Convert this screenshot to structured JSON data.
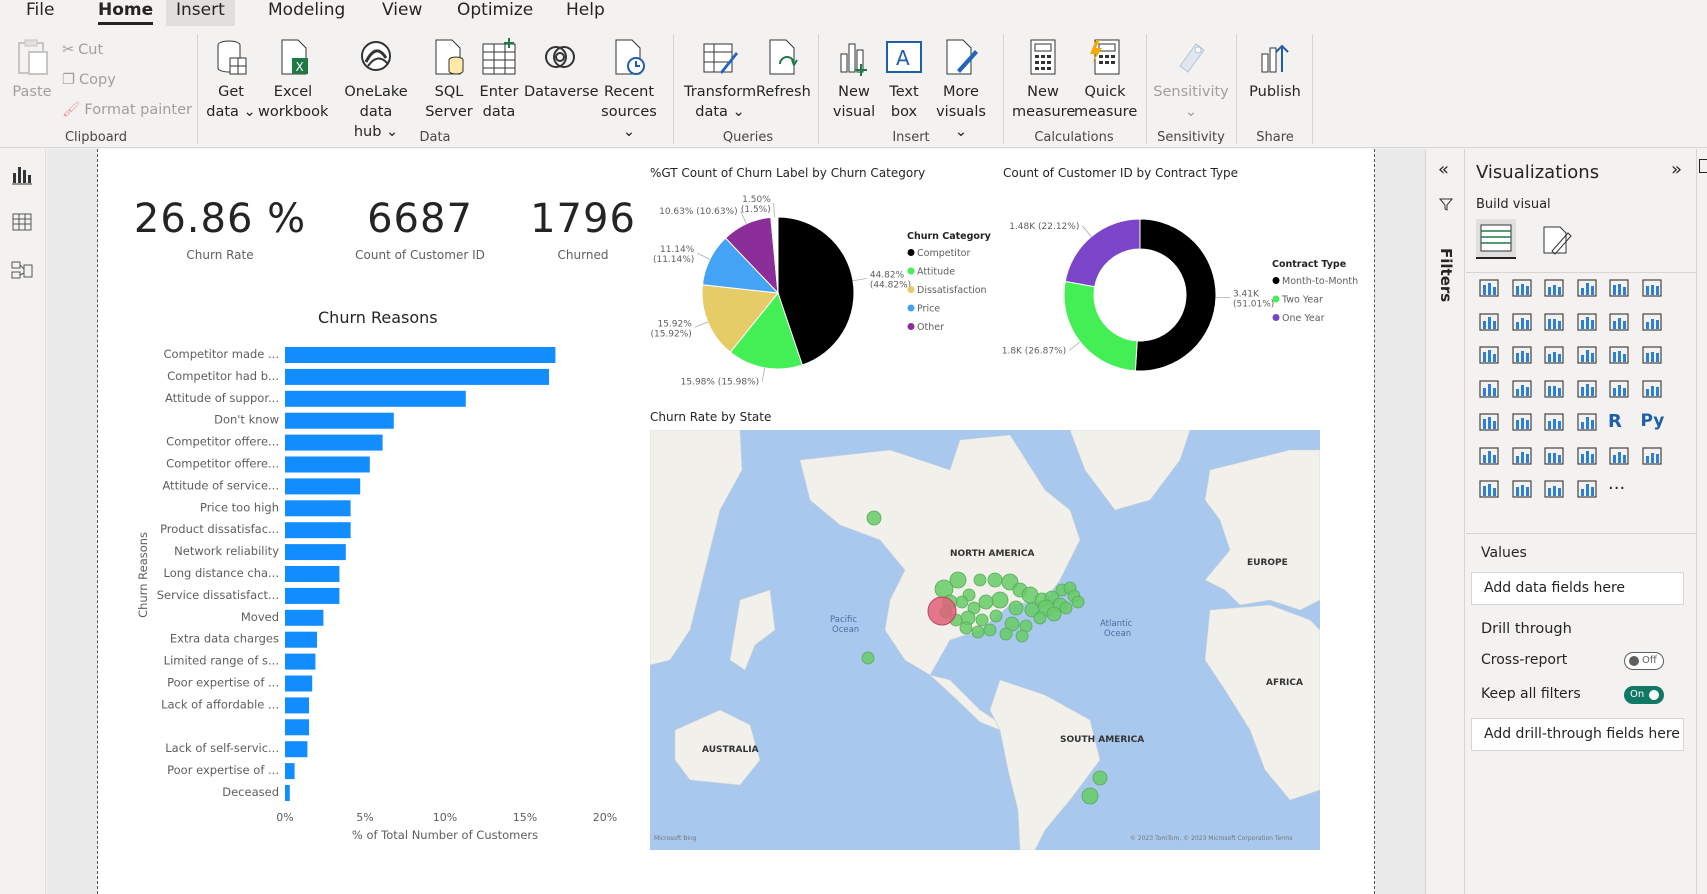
{
  "menu": {
    "tabs": [
      {
        "label": "File"
      },
      {
        "label": "Home"
      },
      {
        "label": "Insert"
      },
      {
        "label": "Modeling"
      },
      {
        "label": "View"
      },
      {
        "label": "Optimize"
      },
      {
        "label": "Help"
      }
    ]
  },
  "ribbon": {
    "clipboard": {
      "paste": "Paste",
      "cut": "Cut",
      "copy": "Copy",
      "format_painter": "Format painter",
      "group": "Clipboard"
    },
    "data": {
      "get_data": "Get\ndata ⌄",
      "excel": "Excel\nworkbook",
      "onelake": "OneLake data\nhub ⌄",
      "sql": "SQL\nServer",
      "enter": "Enter\ndata",
      "dataverse": "Dataverse",
      "recent": "Recent\nsources ⌄",
      "group": "Data"
    },
    "queries": {
      "transform": "Transform\ndata ⌄",
      "refresh": "Refresh",
      "group": "Queries"
    },
    "insert": {
      "new_visual": "New\nvisual",
      "text_box": "Text\nbox",
      "more_visuals": "More\nvisuals ⌄",
      "group": "Insert"
    },
    "calculations": {
      "new_measure": "New\nmeasure",
      "quick_measure": "Quick\nmeasure",
      "group": "Calculations"
    },
    "sensitivity": {
      "btn": "Sensitivity\n⌄",
      "group": "Sensitivity"
    },
    "share": {
      "publish": "Publish",
      "group": "Share"
    }
  },
  "kpis": [
    {
      "value": "26.86 %",
      "label": "Churn Rate"
    },
    {
      "value": "6687",
      "label": "Count of Customer ID"
    },
    {
      "value": "1796",
      "label": "Churned"
    }
  ],
  "chart_data": [
    {
      "type": "bar",
      "orientation": "horizontal",
      "title": "Churn Reasons",
      "xlabel": "% of Total Number of Customers",
      "ylabel": "Churn Reasons",
      "xlim": [
        0,
        20
      ],
      "x_ticks": [
        "0%",
        "5%",
        "10%",
        "15%",
        "20%"
      ],
      "color": "#118dff",
      "categories": [
        "Competitor made ...",
        "Competitor had b...",
        "Attitude of suppor...",
        "Don't know",
        "Competitor offere...",
        "Competitor offere...",
        "Attitude of service...",
        "Price too high",
        "Product dissatisfac...",
        "Network reliability",
        "Long distance cha...",
        "Service dissatisfact...",
        "Moved",
        "Extra data charges",
        "Limited range of s...",
        "Poor expertise of ...",
        "Lack of affordable ...",
        "",
        "Lack of self-servic...",
        "Poor expertise of ...",
        "Deceased"
      ],
      "values": [
        16.9,
        16.5,
        11.3,
        6.8,
        6.1,
        5.3,
        4.7,
        4.1,
        4.1,
        3.8,
        3.4,
        3.4,
        2.4,
        2.0,
        1.9,
        1.7,
        1.5,
        1.5,
        1.4,
        0.6,
        0.3
      ]
    },
    {
      "type": "pie",
      "title": "%GT Count of Churn Label by Churn Category",
      "legend_title": "Churn Category",
      "legend_position": "right",
      "slices": [
        {
          "name": "Competitor",
          "value": 44.82,
          "label": "44.82%\n(44.82%)",
          "color": "#000000"
        },
        {
          "name": "Attitude",
          "value": 15.98,
          "label": "15.98% (15.98%)",
          "color": "#44ee55"
        },
        {
          "name": "Dissatisfaction",
          "value": 15.92,
          "label": "15.92%\n(15.92%)",
          "color": "#e5cc66"
        },
        {
          "name": "Price",
          "value": 11.14,
          "label": "11.14%\n(11.14%)",
          "color": "#44a3f5"
        },
        {
          "name": "Other",
          "value": 10.63,
          "label": "10.63% (10.63%)",
          "color": "#8c2e9a"
        },
        {
          "name": "",
          "value": 1.5,
          "label": "1.50%\n(1.5%)",
          "color": "#ffffff"
        }
      ]
    },
    {
      "type": "pie",
      "subtype": "donut",
      "title": "Count of Customer ID by Contract Type",
      "legend_title": "Contract Type",
      "legend_position": "right",
      "slices": [
        {
          "name": "Month-to-Month",
          "value": 3410,
          "label": "3.41K\n(51.01%)",
          "color": "#000000"
        },
        {
          "name": "Two Year",
          "value": 1800,
          "label": "1.8K (26.87%)",
          "color": "#44ee55"
        },
        {
          "name": "One Year",
          "value": 1480,
          "label": "1.48K (22.12%)",
          "color": "#7b45c9"
        }
      ]
    }
  ],
  "map": {
    "title": "Churn Rate by State",
    "labels": {
      "north_america": "NORTH AMERICA",
      "south_america": "SOUTH AMERICA",
      "europe": "EUROPE",
      "africa": "AFRICA",
      "australia": "AUSTRALIA",
      "pacific": "Pacific\nOcean",
      "atlantic": "Atlantic\nOcean"
    },
    "credit": "© 2023 TomTom, © 2023 Microsoft Corporation  Terms",
    "brand": "Microsoft Bing",
    "bubble_color": "#66cc66",
    "highlight_color": "#e0607a"
  },
  "filters_pane": {
    "label": "Filters"
  },
  "viz_pane": {
    "title": "Visualizations",
    "build_visual": "Build visual",
    "values_label": "Values",
    "values_placeholder": "Add data fields here",
    "drill_through": "Drill through",
    "cross_report": "Cross-report",
    "cross_report_state": "Off",
    "keep_filters": "Keep all filters",
    "keep_filters_state": "On",
    "drill_placeholder": "Add drill-through fields here"
  }
}
